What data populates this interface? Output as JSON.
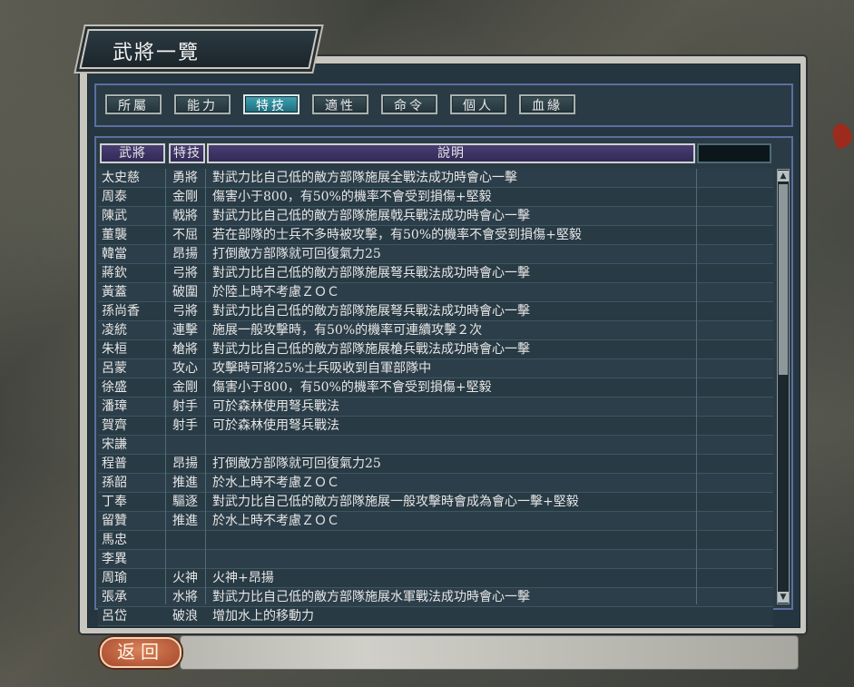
{
  "window": {
    "title": "武將一覽",
    "back_label": "返回"
  },
  "tabs": [
    {
      "label": "所屬",
      "active": false
    },
    {
      "label": "能力",
      "active": false
    },
    {
      "label": "特技",
      "active": true
    },
    {
      "label": "適性",
      "active": false
    },
    {
      "label": "命令",
      "active": false
    },
    {
      "label": "個人",
      "active": false
    },
    {
      "label": "血緣",
      "active": false
    }
  ],
  "table": {
    "headers": {
      "name": "武將",
      "skill": "特技",
      "desc": "說明"
    },
    "rows": [
      {
        "name": "太史慈",
        "skill": "勇將",
        "desc": "對武力比自己低的敵方部隊施展全戰法成功時會心一擊"
      },
      {
        "name": "周泰",
        "skill": "金剛",
        "desc": "傷害小于800，有50%的機率不會受到損傷+堅毅"
      },
      {
        "name": "陳武",
        "skill": "戟將",
        "desc": "對武力比自己低的敵方部隊施展戟兵戰法成功時會心一擊"
      },
      {
        "name": "董襲",
        "skill": "不屈",
        "desc": "若在部隊的士兵不多時被攻擊，有50%的機率不會受到損傷+堅毅"
      },
      {
        "name": "韓當",
        "skill": "昂揚",
        "desc": "打倒敵方部隊就可回復氣力25"
      },
      {
        "name": "蔣欽",
        "skill": "弓將",
        "desc": "對武力比自己低的敵方部隊施展弩兵戰法成功時會心一擊"
      },
      {
        "name": "黃蓋",
        "skill": "破圍",
        "desc": "於陸上時不考慮ＺＯＣ"
      },
      {
        "name": "孫尚香",
        "skill": "弓將",
        "desc": "對武力比自己低的敵方部隊施展弩兵戰法成功時會心一擊"
      },
      {
        "name": "凌統",
        "skill": "連擊",
        "desc": "施展一般攻擊時，有50%的機率可連續攻擊２次"
      },
      {
        "name": "朱桓",
        "skill": "槍將",
        "desc": "對武力比自己低的敵方部隊施展槍兵戰法成功時會心一擊"
      },
      {
        "name": "呂蒙",
        "skill": "攻心",
        "desc": "攻擊時可將25%士兵吸收到自軍部隊中"
      },
      {
        "name": "徐盛",
        "skill": "金剛",
        "desc": "傷害小于800，有50%的機率不會受到損傷+堅毅"
      },
      {
        "name": "潘璋",
        "skill": "射手",
        "desc": "可於森林使用弩兵戰法"
      },
      {
        "name": "賀齊",
        "skill": "射手",
        "desc": "可於森林使用弩兵戰法"
      },
      {
        "name": "宋謙",
        "skill": "",
        "desc": ""
      },
      {
        "name": "程普",
        "skill": "昂揚",
        "desc": "打倒敵方部隊就可回復氣力25"
      },
      {
        "name": "孫韶",
        "skill": "推進",
        "desc": "於水上時不考慮ＺＯＣ"
      },
      {
        "name": "丁奉",
        "skill": "驅逐",
        "desc": "對武力比自己低的敵方部隊施展一般攻擊時會成為會心一擊+堅毅"
      },
      {
        "name": "留贊",
        "skill": "推進",
        "desc": "於水上時不考慮ＺＯＣ"
      },
      {
        "name": "馬忠",
        "skill": "",
        "desc": ""
      },
      {
        "name": "李異",
        "skill": "",
        "desc": ""
      },
      {
        "name": "周瑜",
        "skill": "火神",
        "desc": "火神+昂揚"
      },
      {
        "name": "張承",
        "skill": "水將",
        "desc": "對武力比自己低的敵方部隊施展水軍戰法成功時會心一擊"
      },
      {
        "name": "呂岱",
        "skill": "破浪",
        "desc": "增加水上的移動力"
      }
    ]
  }
}
